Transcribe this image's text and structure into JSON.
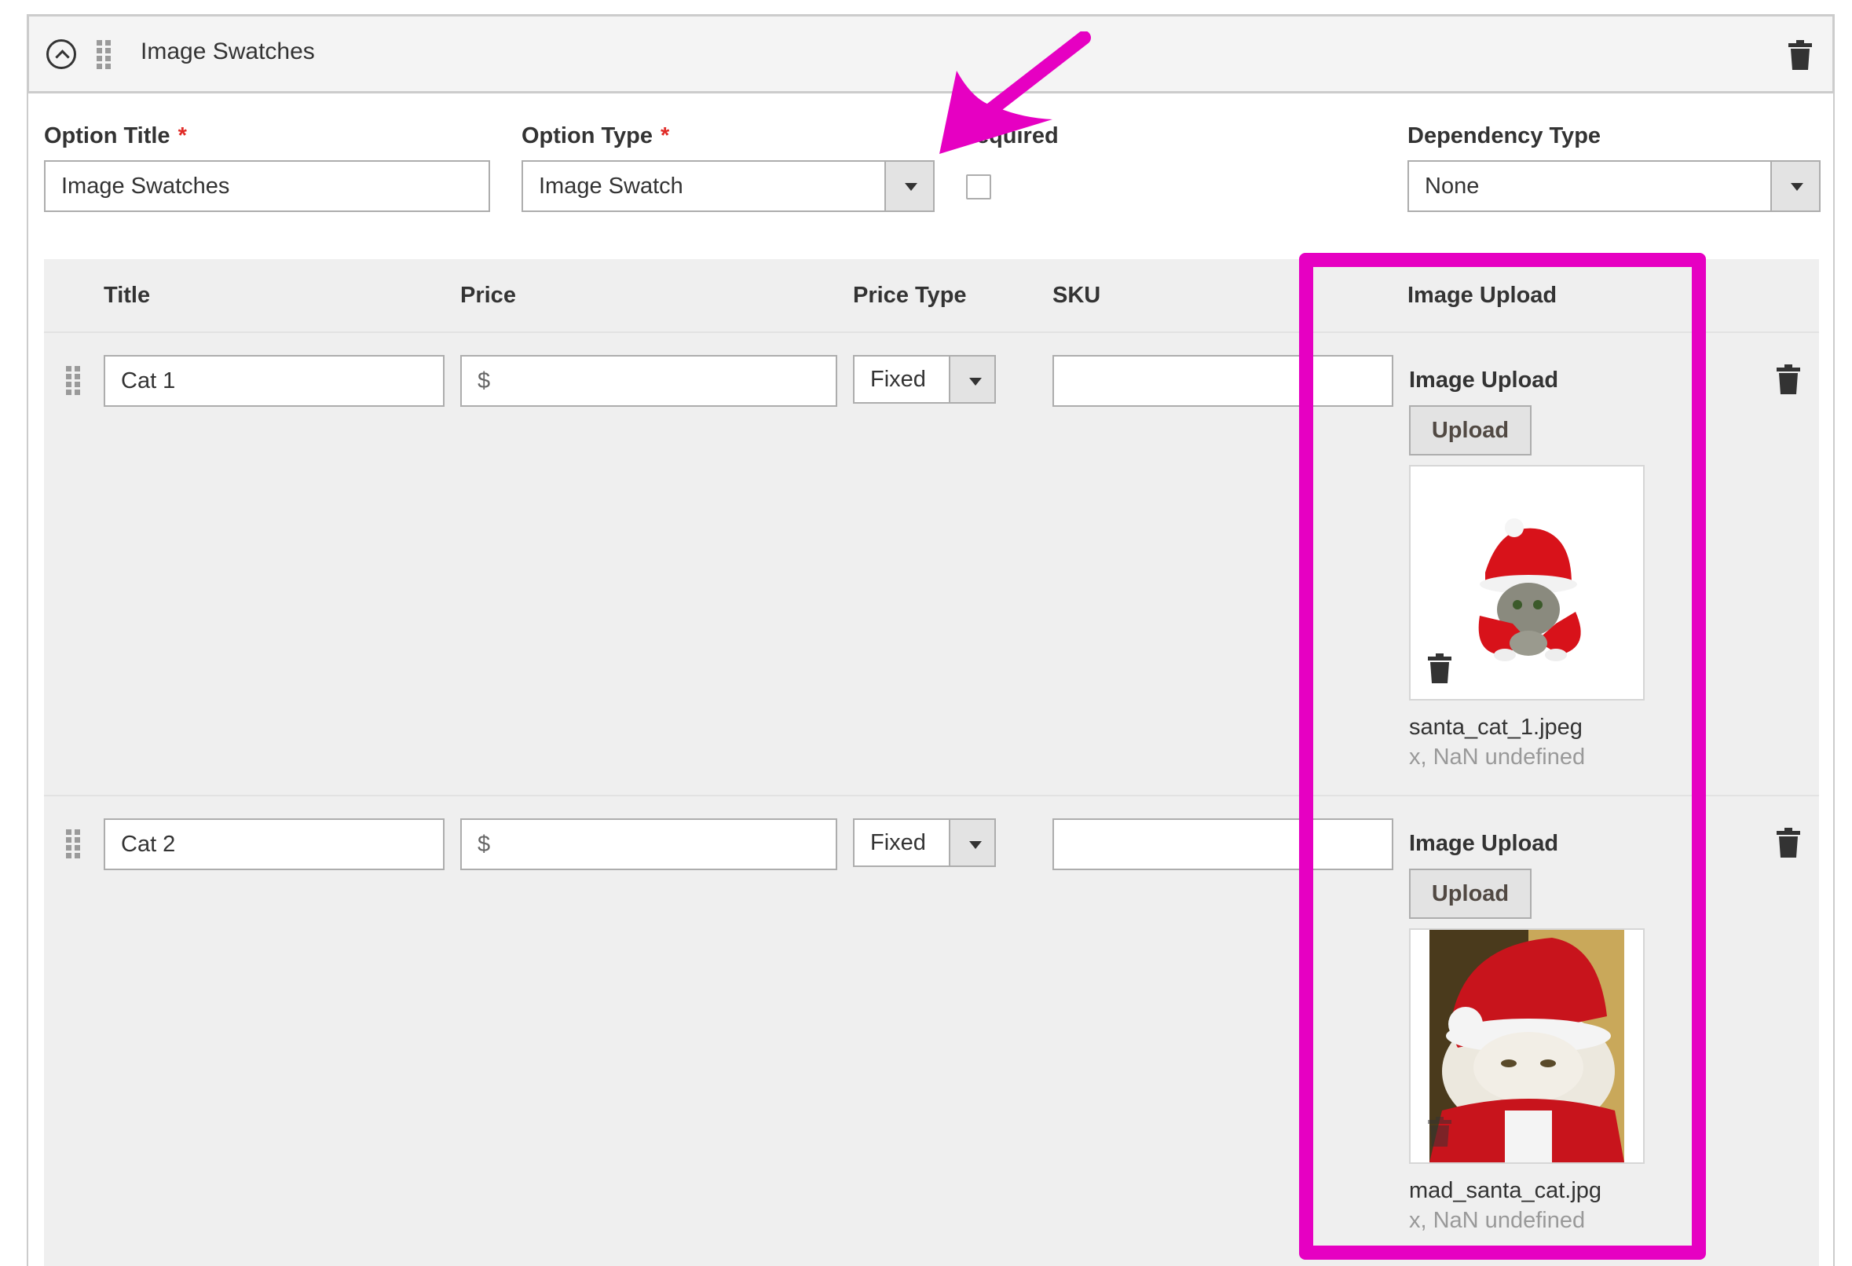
{
  "header": {
    "title": "Image Swatches"
  },
  "fields": {
    "option_title_label": "Option Title",
    "option_title_value": "Image Swatches",
    "option_type_label": "Option Type",
    "option_type_value": "Image Swatch",
    "required_label": "Required",
    "dependency_type_label": "Dependency Type",
    "dependency_type_value": "None",
    "required_marker": "*"
  },
  "table": {
    "columns": [
      "Title",
      "Price",
      "Price Type",
      "SKU",
      "Image Upload"
    ]
  },
  "rows": [
    {
      "title": "Cat 1",
      "price_prefix": "$",
      "price_type": "Fixed",
      "sku": "",
      "image_upload_label": "Image Upload",
      "upload_label": "Upload",
      "file_name": "santa_cat_1.jpeg",
      "file_meta": "x, NaN undefined"
    },
    {
      "title": "Cat 2",
      "price_prefix": "$",
      "price_type": "Fixed",
      "sku": "",
      "image_upload_label": "Image Upload",
      "upload_label": "Upload",
      "file_name": "mad_santa_cat.jpg",
      "file_meta": "x, NaN undefined"
    }
  ],
  "colors": {
    "annotation": "#e600c2",
    "required": "#e02b27",
    "row_bg": "#efefef"
  },
  "icons": [
    "collapse-icon",
    "drag-handle-icon",
    "trash-icon",
    "dropdown-arrow-icon",
    "arrow-annotation"
  ]
}
